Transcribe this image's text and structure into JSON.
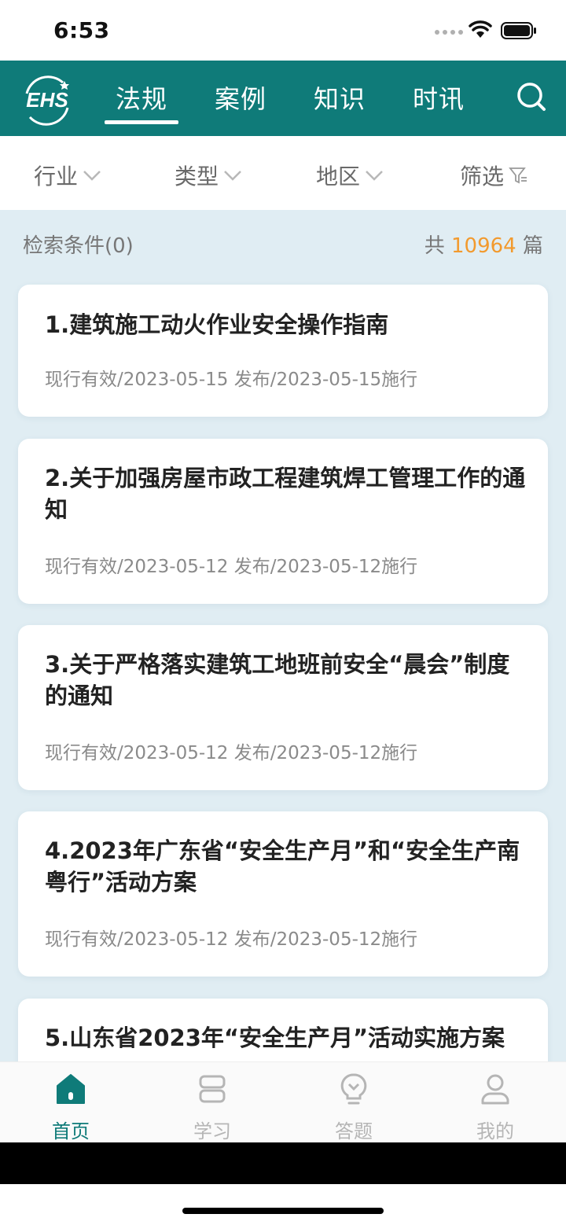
{
  "status": {
    "time": "6:53"
  },
  "header": {
    "logo_text": "EHS",
    "tabs": [
      {
        "label": "法规",
        "active": true
      },
      {
        "label": "案例",
        "active": false
      },
      {
        "label": "知识",
        "active": false
      },
      {
        "label": "时讯",
        "active": false
      }
    ],
    "accent_color": "#0f7b79"
  },
  "filters": {
    "industry": "行业",
    "type": "类型",
    "region": "地区",
    "screen": "筛选"
  },
  "summary": {
    "criteria": "检索条件(0)",
    "total_prefix": "共",
    "total_count": "10964",
    "total_suffix": "篇",
    "count_color": "#f29a2e"
  },
  "articles": [
    {
      "title": "1.建筑施工动火作业安全操作指南",
      "meta": "现行有效/2023-05-15 发布/2023-05-15施行"
    },
    {
      "title": "2.关于加强房屋市政工程建筑焊工管理工作的通知",
      "meta": "现行有效/2023-05-12 发布/2023-05-12施行"
    },
    {
      "title": "3.关于严格落实建筑工地班前安全“晨会”制度的通知",
      "meta": "现行有效/2023-05-12 发布/2023-05-12施行"
    },
    {
      "title": "4.2023年广东省“安全生产月”和“安全生产南粤行”活动方案",
      "meta": "现行有效/2023-05-12 发布/2023-05-12施行"
    },
    {
      "title": "5.山东省2023年“安全生产月”活动实施方案",
      "meta": ""
    }
  ],
  "tabbar": [
    {
      "label": "首页",
      "icon": "home-icon",
      "active": true
    },
    {
      "label": "学习",
      "icon": "book-icon",
      "active": false
    },
    {
      "label": "答题",
      "icon": "lightbulb-icon",
      "active": false
    },
    {
      "label": "我的",
      "icon": "user-icon",
      "active": false
    }
  ]
}
